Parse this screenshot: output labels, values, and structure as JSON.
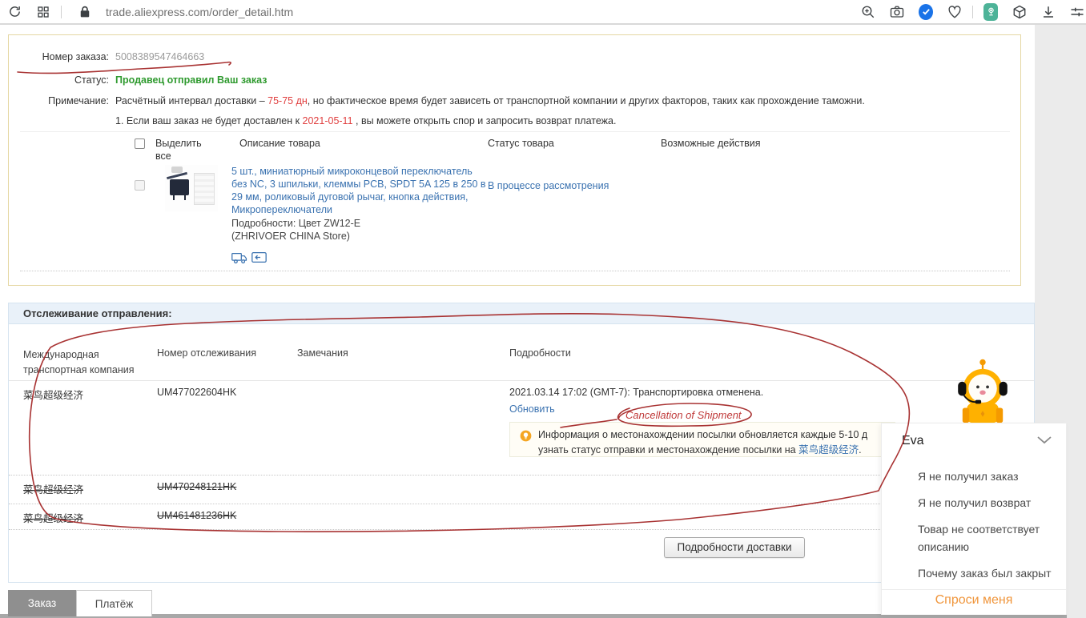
{
  "browser": {
    "url": "trade.aliexpress.com/order_detail.htm"
  },
  "order": {
    "number_label": "Номер заказа:",
    "number": "5008389547464663",
    "status_label": "Статус:",
    "status": "Продавец отправил Ваш заказ",
    "note_label": "Примечание:",
    "note_pre": "Расчётный интервал доставки – ",
    "note_red": "75-75 дн",
    "note_post": ", но фактическое время будет зависеть от транспортной компании и других факторов, таких как прохождение таможни.",
    "note2_pre": "1. Если ваш заказ не будет доставлен к ",
    "note2_red": "2021-05-11",
    "note2_post": " , вы можете открыть спор и запросить возврат платежа."
  },
  "products": {
    "select_all": "Выделить все",
    "col_description": "Описание товара",
    "col_status": "Статус товара",
    "col_actions": "Возможные действия",
    "item": {
      "title": "5 шт., миниатюрный микроконцевой переключатель без NC, 3 шпильки, клеммы PCB, SPDT 5A 125 в 250 в 29 мм, роликовый дуговой рычаг, кнопка действия, Микропереключатели",
      "details": "Подробности: Цвет ZW12-E",
      "store": "(ZHRIVOER CHINA Store)",
      "status": "В процессе рассмотрения"
    }
  },
  "tracking": {
    "title": "Отслеживание отправления:",
    "col_carrier": "Международная транспортная компания",
    "col_number": "Номер отслеживания",
    "col_remarks": "Замечания",
    "col_details": "Подробности",
    "rows": [
      {
        "carrier": "菜鸟超级经济",
        "number": "UM477022604HK"
      },
      {
        "carrier": "菜鸟超级经济",
        "number": "UM470248121HK"
      },
      {
        "carrier": "菜鸟超级经济",
        "number": "UM461481236HK"
      }
    ],
    "detail_line": "2021.03.14 17:02 (GMT-7): Транспортировка отменена.",
    "refresh_link": "Обновить",
    "tip_line1": "Информация о местонахождении посылки обновляется каждые 5-10 д",
    "tip_line2_pre": "узнать статус отправки и местонахождение посылки на ",
    "tip_link": "菜鸟超级经济",
    "tip_line2_post": ".",
    "shipping_details_button": "Подробности доставки"
  },
  "annotations": {
    "cancellation": "Cancellation of Shipment",
    "color": "#a83232"
  },
  "chat": {
    "title": "Eva",
    "items": [
      "Я не получил заказ",
      "Я не получил возврат",
      "Товар не соответствует описанию",
      "Почему заказ был закрыт"
    ],
    "ask_me": "Спроси меня"
  },
  "tabs": {
    "order": "Заказ",
    "payment": "Платёж"
  }
}
